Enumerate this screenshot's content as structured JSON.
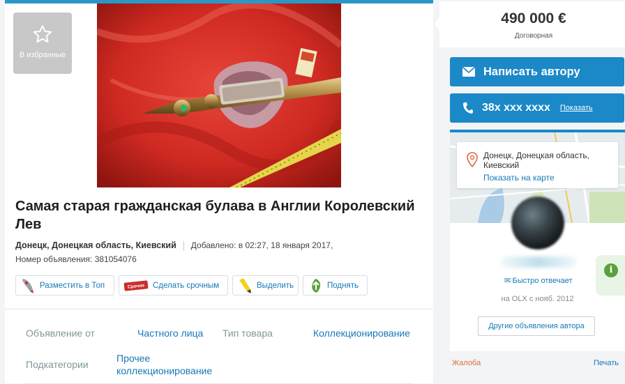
{
  "listing": {
    "favorites_label": "В избранные",
    "title": "Самая старая гражданская булава в Англии Королевский Лев",
    "location": "Донецк, Донецкая область, Киевский",
    "added": "Добавлено: в 02:27, 18 января 2017,",
    "ad_number": "Номер объявления: 381054076",
    "actions": [
      {
        "label": "Разместить в Топ",
        "icon": "rocket-icon"
      },
      {
        "label": "Сделать срочным",
        "icon": "urgent-badge-icon"
      },
      {
        "label": "Выделить",
        "icon": "highlighter-icon"
      },
      {
        "label": "Поднять",
        "icon": "up-arrow-leaf-icon"
      }
    ],
    "params": [
      {
        "key": "Объявление от",
        "value": "Частного лица"
      },
      {
        "key": "Тип товара",
        "value": "Коллекционирование"
      },
      {
        "key": "Подкатегории",
        "value": "Прочее коллекционирование"
      }
    ],
    "urgent_badge_text": "Срочно"
  },
  "sidebar": {
    "price": "490 000 €",
    "negotiable": "Договорная",
    "write_author": "Написать автору",
    "phone": "38x xxx xxxx",
    "show_phone": "Показать",
    "map_location": "Донецк, Донецкая область, Киевский",
    "show_on_map": "Показать на карте",
    "quick_reply": "Быстро отвечает",
    "member_since": "на OLX с нояб. 2012",
    "other_ads": "Другие объявления автора",
    "complain": "Жалоба",
    "print": "Печать"
  },
  "colors": {
    "accent_blue": "#1b88c8",
    "link_blue": "#1778b8",
    "complain_orange": "#e0693f",
    "info_green": "#5aa03c"
  }
}
